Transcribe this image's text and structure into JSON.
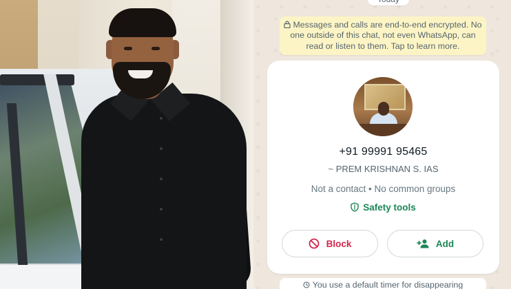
{
  "photo": {
    "alt": "Man in black shirt standing beside a car door"
  },
  "chat": {
    "date_label": "Today",
    "encryption_notice": "Messages and calls are end-to-end encrypted. No one outside of this chat, not even WhatsApp, can read or listen to them. Tap to learn more.",
    "contact": {
      "phone": "+91 99991 95465",
      "name": "~ PREM KRISHNAN S. IAS",
      "meta": "Not a contact • No common groups",
      "safety_label": "Safety tools"
    },
    "actions": {
      "block_label": "Block",
      "add_label": "Add"
    },
    "timer_notice": "You use a default timer for disappearing"
  },
  "colors": {
    "chat_bg": "#efe7dd",
    "notice_bg": "#fdf4c5",
    "green": "#1b8755",
    "red": "#d0264a"
  },
  "icons": {
    "lock": "lock-icon",
    "shield": "shield-icon",
    "block": "block-icon",
    "add_person": "add-person-icon",
    "timer": "timer-icon"
  }
}
